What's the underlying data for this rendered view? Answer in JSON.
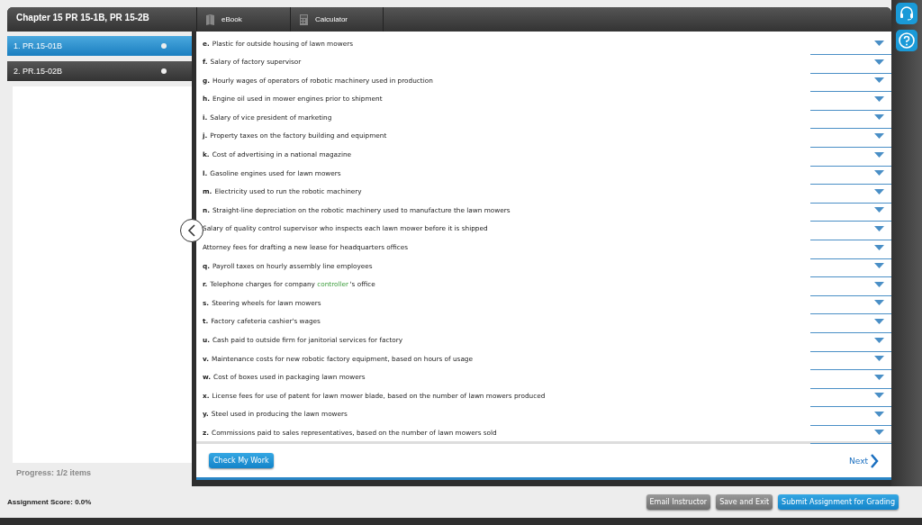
{
  "header": {
    "title": "Chapter 15 PR 15-1B, PR 15-2B",
    "tabs": [
      {
        "label": "eBook",
        "kind": "book"
      },
      {
        "label": "Calculator",
        "kind": "calculator"
      }
    ]
  },
  "sidebar": {
    "items": [
      {
        "label": "1. PR.15-01B",
        "selected": true
      },
      {
        "label": "2. PR.15-02B",
        "selected": false
      }
    ],
    "progress": "Progress:  1/2 items"
  },
  "questions": [
    {
      "letter": "e.",
      "text": "Plastic for outside housing of lawn mowers"
    },
    {
      "letter": "f.",
      "text": "Salary of factory supervisor"
    },
    {
      "letter": "g.",
      "text": "Hourly wages of operators of robotic machinery used in production"
    },
    {
      "letter": "h.",
      "text": "Engine oil used in mower engines prior to shipment"
    },
    {
      "letter": "i.",
      "text": "Salary of vice president of marketing"
    },
    {
      "letter": "j.",
      "text": "Property taxes on the factory building and equipment"
    },
    {
      "letter": "k.",
      "text": "Cost of advertising in a national magazine"
    },
    {
      "letter": "l.",
      "text": "Gasoline engines used for lawn mowers"
    },
    {
      "letter": "m.",
      "text": "Electricity used to run the robotic machinery"
    },
    {
      "letter": "n.",
      "text": "Straight-line depreciation on the robotic machinery used to manufacture the lawn mowers"
    },
    {
      "text": "Salary of quality control supervisor who inspects each lawn mower before it is shipped"
    },
    {
      "text": "Attorney fees for drafting a new lease for headquarters offices"
    },
    {
      "letter": "q.",
      "text": "Payroll taxes on hourly assembly line employees"
    },
    {
      "letter": "r.",
      "text": "Telephone charges for company ",
      "link": "controller",
      "text_after": "'s office"
    },
    {
      "letter": "s.",
      "text": "Steering wheels for lawn mowers"
    },
    {
      "letter": "t.",
      "text": "Factory cafeteria cashier's wages"
    },
    {
      "letter": "u.",
      "text": "Cash paid to outside firm for janitorial services for factory"
    },
    {
      "letter": "v.",
      "text": "Maintenance costs for new robotic factory equipment, based on hours of usage"
    },
    {
      "letter": "w.",
      "text": "Cost of boxes used in packaging lawn mowers"
    },
    {
      "letter": "x.",
      "text": "License fees for use of patent for lawn mower blade, based on the number of lawn mowers produced"
    },
    {
      "letter": "y.",
      "text": "Steel used in producing the lawn mowers"
    },
    {
      "letter": "z.",
      "text": "Commissions paid to sales representatives, based on the number of lawn mowers sold"
    }
  ],
  "content_footer": {
    "check_button": "Check My Work",
    "next": "Next"
  },
  "bottom_bar": {
    "score": "Assignment Score: 0.0%",
    "buttons": [
      {
        "label": "Email Instructor",
        "kind": "grey"
      },
      {
        "label": "Save and Exit",
        "kind": "grey"
      },
      {
        "label": "Submit Assignment for Grading",
        "kind": "blue"
      }
    ]
  }
}
